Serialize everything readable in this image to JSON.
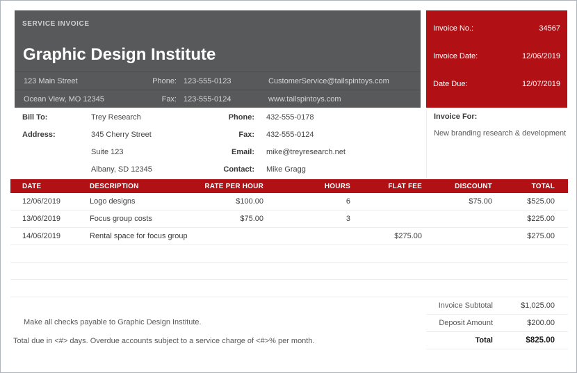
{
  "company": {
    "doc_type": "SERVICE INVOICE",
    "name": "Graphic Design Institute",
    "address_line1": "123 Main Street",
    "address_line2": "Ocean View, MO 12345",
    "phone_label": "Phone:",
    "phone": "123-555-0123",
    "fax_label": "Fax:",
    "fax": "123-555-0124",
    "email": "CustomerService@tailspintoys.com",
    "website": "www.tailspintoys.com"
  },
  "invoice_meta": {
    "number_label": "Invoice No.:",
    "number": "34567",
    "date_label": "Invoice Date:",
    "date": "12/06/2019",
    "due_label": "Date Due:",
    "due": "12/07/2019"
  },
  "bill_to": {
    "bill_to_label": "Bill To:",
    "name": "Trey Research",
    "address_label": "Address:",
    "address_line1": "345 Cherry Street",
    "address_line2": "Suite 123",
    "address_line3": "Albany, SD 12345",
    "phone_label": "Phone:",
    "phone": "432-555-0178",
    "fax_label": "Fax:",
    "fax": "432-555-0124",
    "email_label": "Email:",
    "email": "mike@treyresearch.net",
    "contact_label": "Contact:",
    "contact": "Mike Gragg"
  },
  "invoice_for": {
    "label": "Invoice For:",
    "value": "New branding research & development"
  },
  "items_table": {
    "headers": {
      "date": "DATE",
      "description": "DESCRIPTION",
      "rate": "RATE PER HOUR",
      "hours": "HOURS",
      "flat_fee": "FLAT FEE",
      "discount": "DISCOUNT",
      "total": "TOTAL"
    },
    "rows": [
      {
        "date": "12/06/2019",
        "description": "Logo designs",
        "rate": "$100.00",
        "hours": "6",
        "flat_fee": "",
        "discount": "$75.00",
        "total": "$525.00"
      },
      {
        "date": "13/06/2019",
        "description": "Focus group costs",
        "rate": "$75.00",
        "hours": "3",
        "flat_fee": "",
        "discount": "",
        "total": "$225.00"
      },
      {
        "date": "14/06/2019",
        "description": "Rental space for focus group",
        "rate": "",
        "hours": "",
        "flat_fee": "$275.00",
        "discount": "",
        "total": "$275.00"
      }
    ]
  },
  "totals": {
    "subtotal_label": "Invoice Subtotal",
    "subtotal": "$1,025.00",
    "deposit_label": "Deposit Amount",
    "deposit": "$200.00",
    "total_label": "Total",
    "total": "$825.00"
  },
  "notes": {
    "line1": "Make all checks payable to Graphic Design Institute.",
    "line2": "Total due in <#> days. Overdue accounts subject to a service charge of <#>% per month."
  },
  "colors": {
    "accent_red": "#B11015",
    "header_gray": "#58595B"
  }
}
